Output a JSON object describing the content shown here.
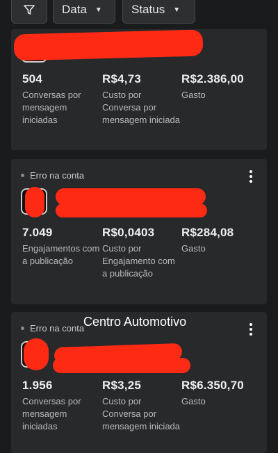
{
  "filters": {
    "date_label": "Data",
    "status_label": "Status"
  },
  "cards": [
    {
      "metrics": [
        {
          "value": "504",
          "label": "Conversas por mensagem iniciadas"
        },
        {
          "value": "R$4,73",
          "label": "Custo por Conversa por mensagem iniciada"
        },
        {
          "value": "R$2.386,00",
          "label": "Gasto"
        }
      ]
    },
    {
      "status": "Erro na conta",
      "metrics": [
        {
          "value": "7.049",
          "label": "Engajamentos com a publicação"
        },
        {
          "value": "R$0,0403",
          "label": "Custo por Engajamento com a publicação"
        },
        {
          "value": "R$284,08",
          "label": "Gasto"
        }
      ]
    },
    {
      "status": "Erro na conta",
      "metrics": [
        {
          "value": "1.956",
          "label": "Conversas por mensagem iniciadas"
        },
        {
          "value": "R$3,25",
          "label": "Custo por Conversa por mensagem iniciada"
        },
        {
          "value": "R$6.350,70",
          "label": "Gasto"
        }
      ]
    }
  ],
  "overlay_caption": "Centro Automotivo",
  "colors": {
    "background": "#1a1b1d",
    "card": "#28292b",
    "redaction": "#ff2a14"
  },
  "icons": [
    "filter-icon",
    "caret-down-icon",
    "more-vert-icon",
    "status-dot-icon"
  ]
}
